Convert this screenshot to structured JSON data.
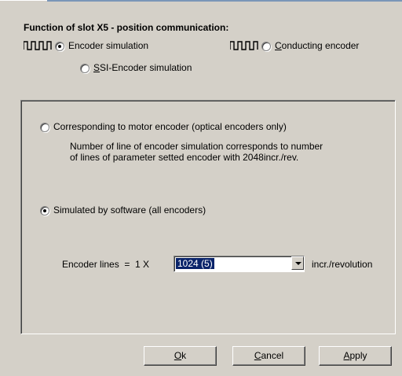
{
  "header": {
    "title": "Function of slot X5 - position communication:"
  },
  "slot_function": {
    "encoder_simulation": {
      "label": "Encoder simulation",
      "checked": true
    },
    "conducting_encoder": {
      "label_prefix": "",
      "accel": "C",
      "label_rest": "onducting encoder",
      "checked": false
    },
    "ssi_encoder_simulation": {
      "accel": "S",
      "label_rest": "SI-Encoder simulation",
      "checked": false
    }
  },
  "panel": {
    "corresponding_option": {
      "label": "Corresponding to motor encoder (optical encoders only)",
      "checked": false,
      "description_line1": "Number of line of encoder simulation corresponds to number",
      "description_line2": "of lines of parameter setted encoder with 2048incr./rev."
    },
    "software_option": {
      "label": "Simulated  by software (all encoders)",
      "checked": true
    },
    "encoder_lines": {
      "label": "Encoder lines  =  1 X",
      "selected": "1024 (5)",
      "unit": "incr./revolution"
    }
  },
  "buttons": {
    "ok": {
      "accel": "O",
      "rest": "k"
    },
    "cancel": {
      "accel": "C",
      "rest": "ancel"
    },
    "apply": {
      "accel": "A",
      "rest": "pply"
    }
  },
  "colors": {
    "face": "#d4d0c8",
    "highlight": "#0a246a"
  }
}
